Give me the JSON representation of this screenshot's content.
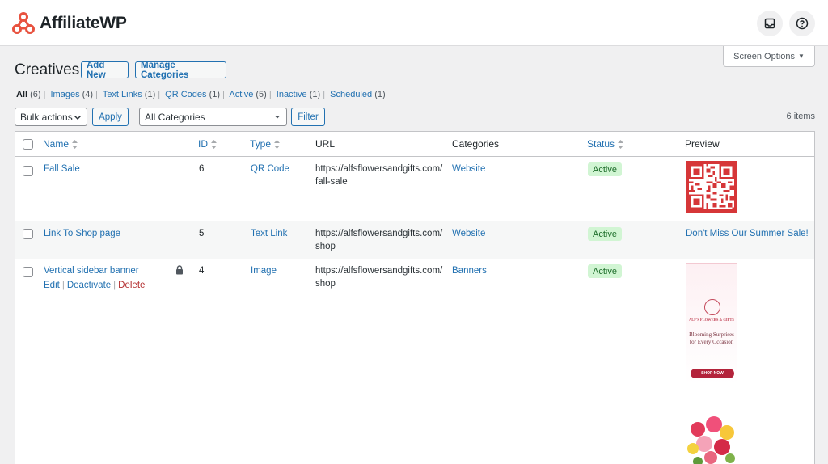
{
  "brand": {
    "name": "AffiliateWP",
    "accent": "#e8523f"
  },
  "header": {
    "inbox_icon": "inbox-icon",
    "help_icon": "help-icon"
  },
  "screen_options": {
    "label": "Screen Options"
  },
  "page": {
    "title": "Creatives",
    "add_new": "Add New",
    "manage_categories": "Manage Categories"
  },
  "filters": {
    "all": {
      "label": "All",
      "count": "(6)"
    },
    "images": {
      "label": "Images",
      "count": "(4)"
    },
    "text_links": {
      "label": "Text Links",
      "count": "(1)"
    },
    "qr_codes": {
      "label": "QR Codes",
      "count": "(1)"
    },
    "active": {
      "label": "Active",
      "count": "(5)"
    },
    "inactive": {
      "label": "Inactive",
      "count": "(1)"
    },
    "scheduled": {
      "label": "Scheduled",
      "count": "(1)"
    }
  },
  "toolbar": {
    "bulk_actions": "Bulk actions",
    "apply": "Apply",
    "categories": "All Categories",
    "filter": "Filter",
    "items_count": "6 items"
  },
  "columns": {
    "name": "Name",
    "id": "ID",
    "type": "Type",
    "url": "URL",
    "categories": "Categories",
    "status": "Status",
    "preview": "Preview"
  },
  "rows": [
    {
      "name": "Fall Sale",
      "id": "6",
      "type": "QR Code",
      "url": "https://alfsflowersandgifts.com/fall-sale",
      "category": "Website",
      "status": "Active"
    },
    {
      "name": "Link To Shop page",
      "id": "5",
      "type": "Text Link",
      "url": "https://alfsflowersandgifts.com/shop",
      "category": "Website",
      "status": "Active",
      "preview_text": "Don't Miss Our Summer Sale!"
    },
    {
      "name": "Vertical sidebar banner",
      "id": "4",
      "type": "Image",
      "url": "https://alfsflowersandgifts.com/shop",
      "category": "Banners",
      "status": "Active",
      "actions": {
        "edit": "Edit",
        "deactivate": "Deactivate",
        "delete": "Delete"
      },
      "banner": {
        "brand": "ALF'S FLOWERS & GIFTS",
        "tagline": "Blooming Surprises for Every Occasion",
        "cta": "SHOP NOW"
      }
    }
  ]
}
